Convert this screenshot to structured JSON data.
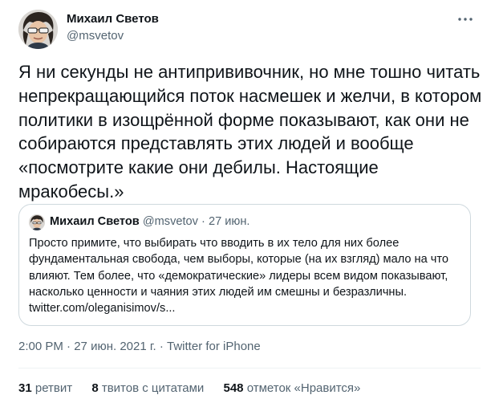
{
  "author": {
    "name": "Михаил Светов",
    "handle": "@msvetov"
  },
  "tweet": {
    "text": "Я ни секунды не антипрививочник, но мне тошно читать непрекращающийся поток насмешек и желчи, в котором политики в изощрённой форме показывают, как они не собираются представлять этих людей и вообще «посмотрите какие они дебилы. Настоящие мракобесы.»"
  },
  "quote": {
    "name": "Михаил Светов",
    "handle": "@msvetov",
    "separator": "·",
    "date": "27 июн.",
    "text": "Просто примите, что выбирать что вводить в их тело для них более фундаментальная свобода, чем выборы, которые (на их взгляд) мало на что влияют. Тем более, что «демократические» лидеры всем видом показывают, насколько ценности и чаяния этих людей им смешны и безразличны.",
    "link": "twitter.com/oleganisimov/s..."
  },
  "meta": {
    "time": "2:00 PM",
    "separator": " · ",
    "date": "27 июн. 2021 г.",
    "source": "Twitter for iPhone"
  },
  "stats": {
    "retweets": {
      "count": "31",
      "label": "ретвит"
    },
    "quotes": {
      "count": "8",
      "label": "твитов с цитатами"
    },
    "likes": {
      "count": "548",
      "label": "отметок «Нравится»"
    }
  },
  "icons": {
    "more": "more-horizontal-icon"
  },
  "colors": {
    "text": "#0f1419",
    "secondary": "#536471",
    "border": "#cfd9de",
    "divider": "#eff3f4"
  }
}
